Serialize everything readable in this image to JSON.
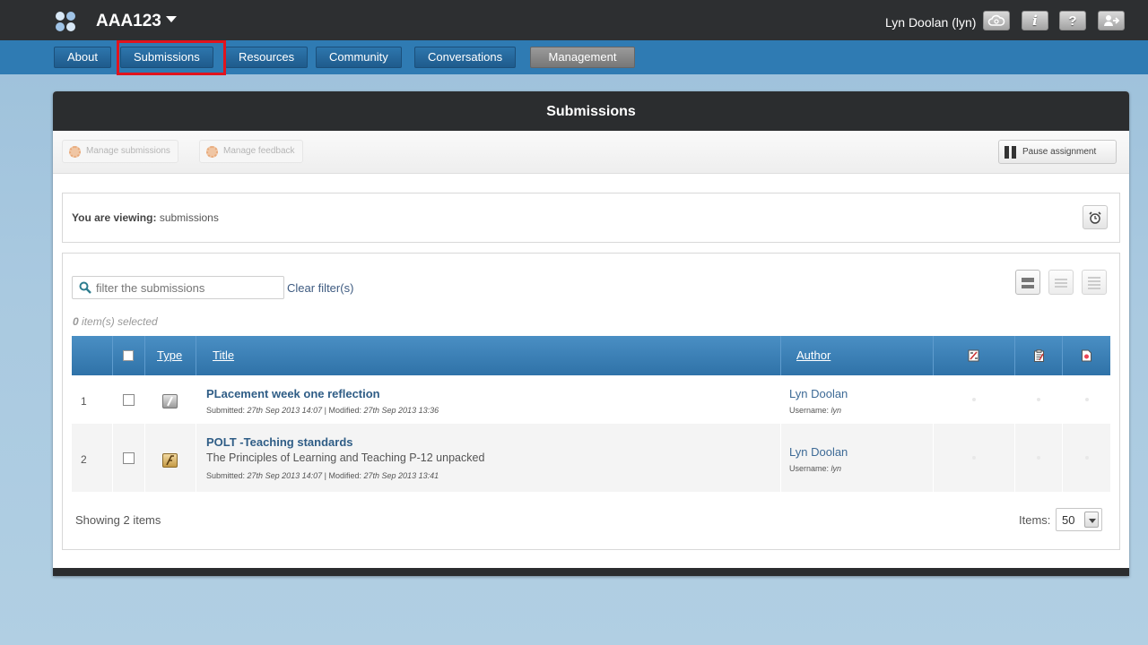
{
  "header": {
    "site_title": "AAA123",
    "user": "Lyn Doolan (lyn)",
    "icons": [
      "cloud-sync-icon",
      "info-icon",
      "help-icon",
      "logout-icon"
    ],
    "info_glyph": "i",
    "help_glyph": "?"
  },
  "nav": {
    "tabs": [
      {
        "label": "About"
      },
      {
        "label": "Submissions",
        "highlighted": true
      },
      {
        "label": "Resources"
      },
      {
        "label": "Community"
      },
      {
        "label": "Conversations"
      },
      {
        "label": "Management"
      }
    ]
  },
  "panel": {
    "title": "Submissions",
    "toolbar": {
      "manage_submissions": "Manage submissions",
      "manage_feedback": "Manage feedback",
      "pause_assignment": "Pause assignment"
    },
    "viewing": {
      "label": "You are viewing:",
      "value": "submissions"
    },
    "filter": {
      "placeholder": "filter the submissions",
      "clear_label": "Clear filter(s)"
    },
    "selected": {
      "count": "0",
      "suffix": "item(s) selected"
    },
    "table": {
      "columns": {
        "type": "Type",
        "title": "Title",
        "author": "Author"
      },
      "rows": [
        {
          "num": "1",
          "title": "PLacement week one reflection",
          "description": "",
          "submitted_label": "Submitted:",
          "submitted": "27th Sep 2013 14:07",
          "modified_label": "| Modified:",
          "modified": "27th Sep 2013 13:36",
          "author": "Lyn Doolan",
          "username_label": "Username:",
          "username": "lyn"
        },
        {
          "num": "2",
          "title": "POLT -Teaching standards",
          "description": "The Principles of Learning and Teaching P-12 unpacked",
          "submitted_label": "Submitted:",
          "submitted": "27th Sep 2013 14:07",
          "modified_label": "| Modified:",
          "modified": "27th Sep 2013 13:41",
          "author": "Lyn Doolan",
          "username_label": "Username:",
          "username": "lyn"
        }
      ]
    },
    "footer": {
      "showing": "Showing 2 items",
      "items_label": "Items:",
      "items_value": "50"
    }
  },
  "colors": {
    "topbar": "#2d2f31",
    "navbar": "#2f7bb3",
    "table_header": "#3a80b8",
    "highlight": "#e0141e"
  }
}
